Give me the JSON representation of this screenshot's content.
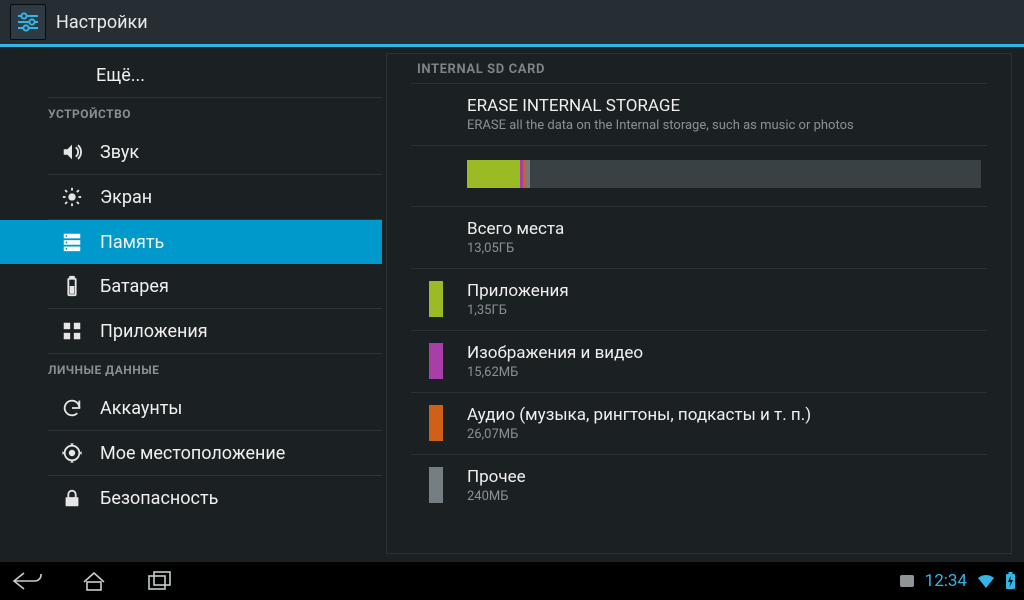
{
  "app": {
    "title": "Настройки"
  },
  "nav": {
    "more": "Ещё...",
    "headers": {
      "device": "УСТРОЙСТВО",
      "personal": "ЛИЧНЫЕ ДАННЫЕ"
    },
    "items": {
      "sound": "Звук",
      "display": "Экран",
      "storage": "Память",
      "battery": "Батарея",
      "apps": "Приложения",
      "accounts": "Аккаунты",
      "location": "Мое местоположение",
      "security": "Безопасность"
    }
  },
  "detail": {
    "section": "INTERNAL SD CARD",
    "erase": {
      "title": "ERASE INTERNAL STORAGE",
      "sub": "ERASE all the data on the Internal storage, such as music or photos"
    },
    "bar": {
      "segments": [
        {
          "color": "#9bbb25",
          "pct": 10.3
        },
        {
          "color": "#a83fa8",
          "pct": 0.5
        },
        {
          "color": "#d06018",
          "pct": 0.6
        },
        {
          "color": "#757e82",
          "pct": 0.8
        }
      ]
    },
    "rows": {
      "total": {
        "title": "Всего места",
        "sub": "13,05ГБ",
        "color": ""
      },
      "apps": {
        "title": "Приложения",
        "sub": "1,35ГБ",
        "color": "#9bbb25"
      },
      "images": {
        "title": "Изображения и видео",
        "sub": "15,62МБ",
        "color": "#a83fa8"
      },
      "audio": {
        "title": "Аудио (музыка, рингтоны, подкасты и т. п.)",
        "sub": "26,07МБ",
        "color": "#d06018"
      },
      "misc": {
        "title": "Прочее",
        "sub": "240МБ",
        "color": "#757e82"
      }
    }
  },
  "status": {
    "clock": "12:34"
  }
}
